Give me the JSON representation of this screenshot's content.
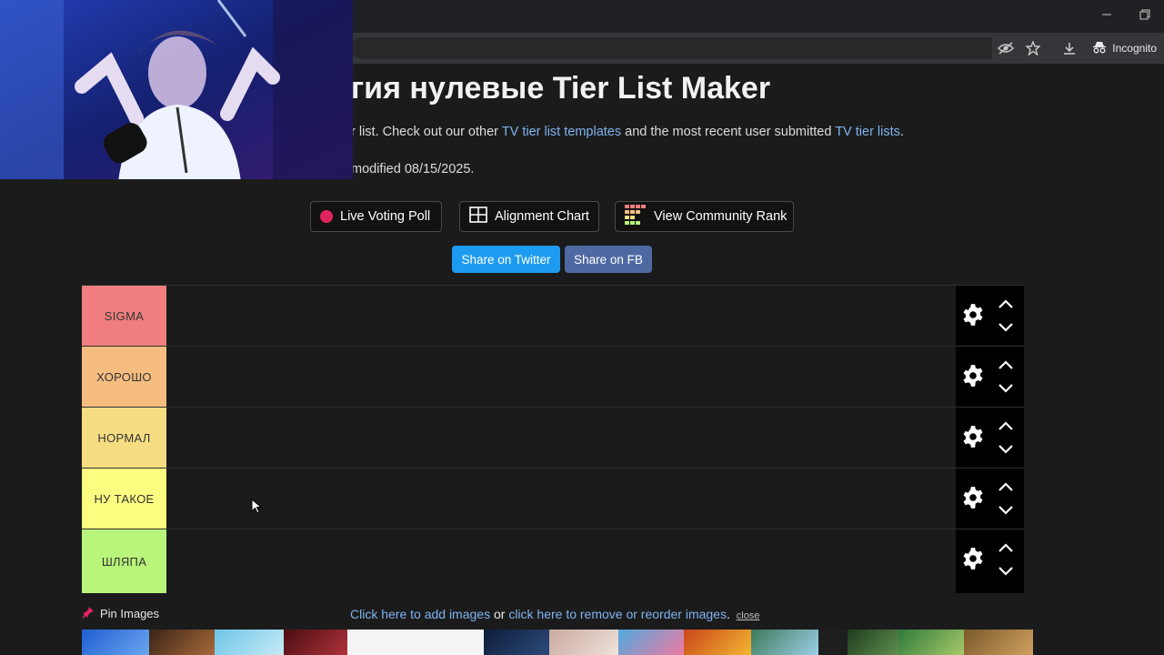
{
  "browser": {
    "minimize_icon": "minimize-icon",
    "restore_icon": "restore-icon",
    "incognito_label": "Incognito"
  },
  "header": {
    "title": "гия нулевые Tier List Maker",
    "intro_prefix": "r list. Check out our other ",
    "intro_link1": "TV tier list templates",
    "intro_mid": " and the most recent user submitted ",
    "intro_link2": "TV tier lists",
    "intro_suffix": ".",
    "modified": "modified 08/15/2025."
  },
  "actions": {
    "live_voting": "Live Voting Poll",
    "alignment_chart": "Alignment Chart",
    "community_rank": "View Community Rank",
    "share_twitter": "Share on Twitter",
    "share_fb": "Share on FB"
  },
  "tiers": [
    {
      "label": "SIGMA",
      "color": "#f07e7e"
    },
    {
      "label": "ХОРОШО",
      "color": "#f6bd80"
    },
    {
      "label": "НОРМАЛ",
      "color": "#f7dd82"
    },
    {
      "label": "НУ ТАКОЕ",
      "color": "#fbfc80"
    },
    {
      "label": "ШЛЯПА",
      "color": "#b9f47b"
    }
  ],
  "footer": {
    "pin_label": "Pin Images",
    "add_link": "Click here to add images",
    "or_text": " or ",
    "remove_link": "click here to remove or reorder images",
    "period": ".",
    "close_label": "close"
  },
  "colors": {
    "twitter": "#1d9bf0",
    "facebook": "#4e69a2",
    "link": "#7fb3ee"
  }
}
